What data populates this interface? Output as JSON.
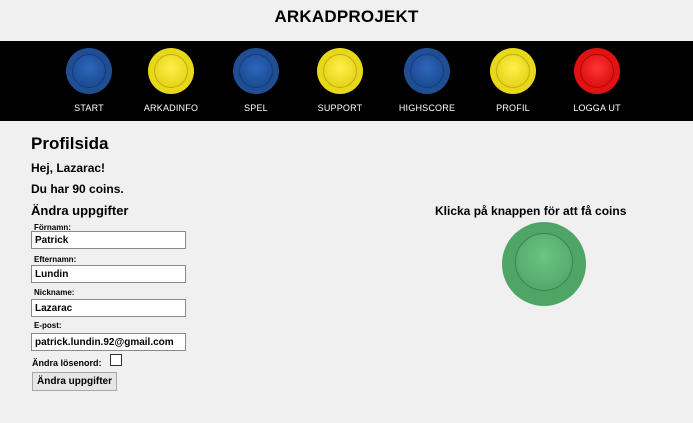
{
  "header": {
    "title": "ARKADPROJEKT"
  },
  "nav": {
    "items": [
      {
        "label": "START",
        "color": "blue"
      },
      {
        "label": "ARKADINFO",
        "color": "yellow"
      },
      {
        "label": "SPEL",
        "color": "blue"
      },
      {
        "label": "SUPPORT",
        "color": "yellow"
      },
      {
        "label": "HIGHSCORE",
        "color": "blue"
      },
      {
        "label": "PROFIL",
        "color": "yellow"
      },
      {
        "label": "LOGGA UT",
        "color": "red"
      }
    ]
  },
  "colors": {
    "blue": "#1f4e94",
    "yellow": "#e7d81a",
    "red": "#e21212",
    "green": "#4fa565",
    "nav_bg": "#000000",
    "page_bg": "#f0f0f0"
  },
  "profile": {
    "title": "Profilsida",
    "greeting": "Hej, Lazarac!",
    "coins_text": "Du har 90 coins."
  },
  "form": {
    "title": "Ändra uppgifter",
    "fields": [
      {
        "label": "Förnamn:",
        "value": "Patrick"
      },
      {
        "label": "Efternamn:",
        "value": "Lundin"
      },
      {
        "label": "Nickname:",
        "value": "Lazarac"
      },
      {
        "label": "E-post:",
        "value": "patrick.lundin.92@gmail.com"
      }
    ],
    "password_label": "Ändra lösenord:",
    "submit_label": "Ändra uppgifter"
  },
  "coins": {
    "prompt": "Klicka på knappen för att få coins",
    "button_icon": "green-arcade-button-icon"
  }
}
